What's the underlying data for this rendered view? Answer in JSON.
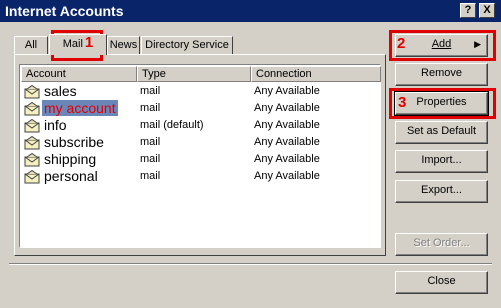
{
  "window": {
    "title": "Internet Accounts",
    "help_label": "?",
    "close_label": "X"
  },
  "tabs": [
    {
      "label": "All"
    },
    {
      "label": "Mail",
      "annotation": "1"
    },
    {
      "label": "News"
    },
    {
      "label": "Directory Service"
    }
  ],
  "list": {
    "columns": [
      "Account",
      "Type",
      "Connection"
    ],
    "rows": [
      {
        "account": "sales",
        "type": "mail",
        "connection": "Any Available"
      },
      {
        "account": "my account",
        "type": "mail",
        "connection": "Any Available"
      },
      {
        "account": "info",
        "type": "mail (default)",
        "connection": "Any Available"
      },
      {
        "account": "subscribe",
        "type": "mail",
        "connection": "Any Available"
      },
      {
        "account": "shipping",
        "type": "mail",
        "connection": "Any Available"
      },
      {
        "account": "personal",
        "type": "mail",
        "connection": "Any Available"
      }
    ],
    "selected_row": "my account"
  },
  "buttons": {
    "add": "Add",
    "remove": "Remove",
    "properties": "Properties",
    "set_default": "Set as Default",
    "import": "Import...",
    "export": "Export...",
    "set_order": "Set Order...",
    "close": "Close"
  },
  "annotations": {
    "n2": "2",
    "n3": "3"
  },
  "colors": {
    "titlebar": "#0a246a",
    "annotation_red": "#e00000",
    "selection": "#6b86b9"
  },
  "icons": {
    "account_icon": "mail-envelope-icon"
  }
}
